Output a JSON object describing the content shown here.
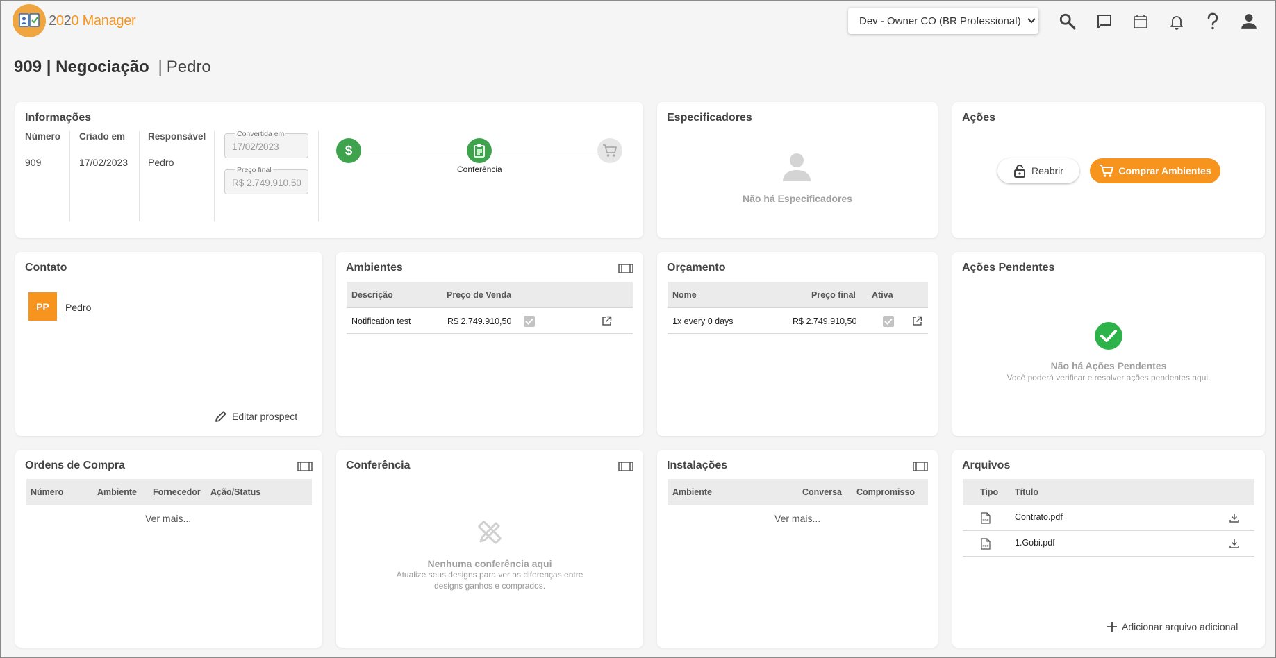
{
  "header": {
    "logo_text_prefix": "2",
    "logo_text_accent": "0",
    "logo_text_mid": "2",
    "logo_text_accent2": "0",
    "logo_text_suffix": " Manager",
    "org_selector": "Dev - Owner CO (BR Professional)",
    "icons": [
      "search-icon",
      "chat-icon",
      "calendar-icon",
      "bell-icon",
      "help-icon",
      "account-icon"
    ]
  },
  "page": {
    "number": "909",
    "stage": "Negociação",
    "separator": "|",
    "client_name": "Pedro"
  },
  "informacoes": {
    "title": "Informações",
    "numero_label": "Número",
    "numero_value": "909",
    "criado_label": "Criado em",
    "criado_value": "17/02/2023",
    "responsavel_label": "Responsável",
    "responsavel_value": "Pedro",
    "convertida_label": "Convertida em",
    "convertida_value": "17/02/2023",
    "preco_label": "Preço final",
    "preco_value": "R$ 2.749.910,50",
    "current_step_label": "Conferência"
  },
  "especificadores": {
    "title": "Especificadores",
    "empty": "Não há Especificadores"
  },
  "acoes": {
    "title": "Ações",
    "reopen_label": "Reabrir",
    "buy_label": "Comprar Ambientes"
  },
  "contato": {
    "title": "Contato",
    "initials": "PP",
    "name": "Pedro",
    "edit_label": "Editar prospect"
  },
  "ambientes": {
    "title": "Ambientes",
    "col_descricao": "Descrição",
    "col_preco": "Preço de Venda",
    "rows": [
      {
        "descricao": "Notification test",
        "preco": "R$ 2.749.910,50"
      }
    ]
  },
  "orcamento": {
    "title": "Orçamento",
    "col_nome": "Nome",
    "col_preco": "Preço final",
    "col_ativa": "Ativa",
    "rows": [
      {
        "nome": "1x every 0 days",
        "preco": "R$ 2.749.910,50"
      }
    ]
  },
  "acoes_pendentes": {
    "title": "Ações Pendentes",
    "empty": "Não há Ações Pendentes",
    "empty_sub": "Você poderá verificar e resolver ações pendentes aqui."
  },
  "ordens": {
    "title": "Ordens de Compra",
    "col_numero": "Número",
    "col_ambiente": "Ambiente",
    "col_fornecedor": "Fornecedor",
    "col_acao": "Ação/Status",
    "see_more": "Ver mais..."
  },
  "conferencia": {
    "title": "Conferência",
    "empty": "Nenhuma conferência aqui",
    "empty_sub_1": "Atualize seus designs para ver as diferenças entre",
    "empty_sub_2": "designs ganhos e comprados."
  },
  "instalacoes": {
    "title": "Instalações",
    "col_ambiente": "Ambiente",
    "col_conversa": "Conversa",
    "col_compromisso": "Compromisso",
    "see_more": "Ver mais..."
  },
  "arquivos": {
    "title": "Arquivos",
    "col_tipo": "Tipo",
    "col_titulo": "Título",
    "rows": [
      {
        "titulo": "Contrato.pdf"
      },
      {
        "titulo": "1.Gobi.pdf"
      }
    ],
    "add_label": "Adicionar arquivo adicional"
  },
  "colors": {
    "accent": "#f7941d",
    "success": "#3fa34d",
    "check_green": "#2db34a"
  }
}
